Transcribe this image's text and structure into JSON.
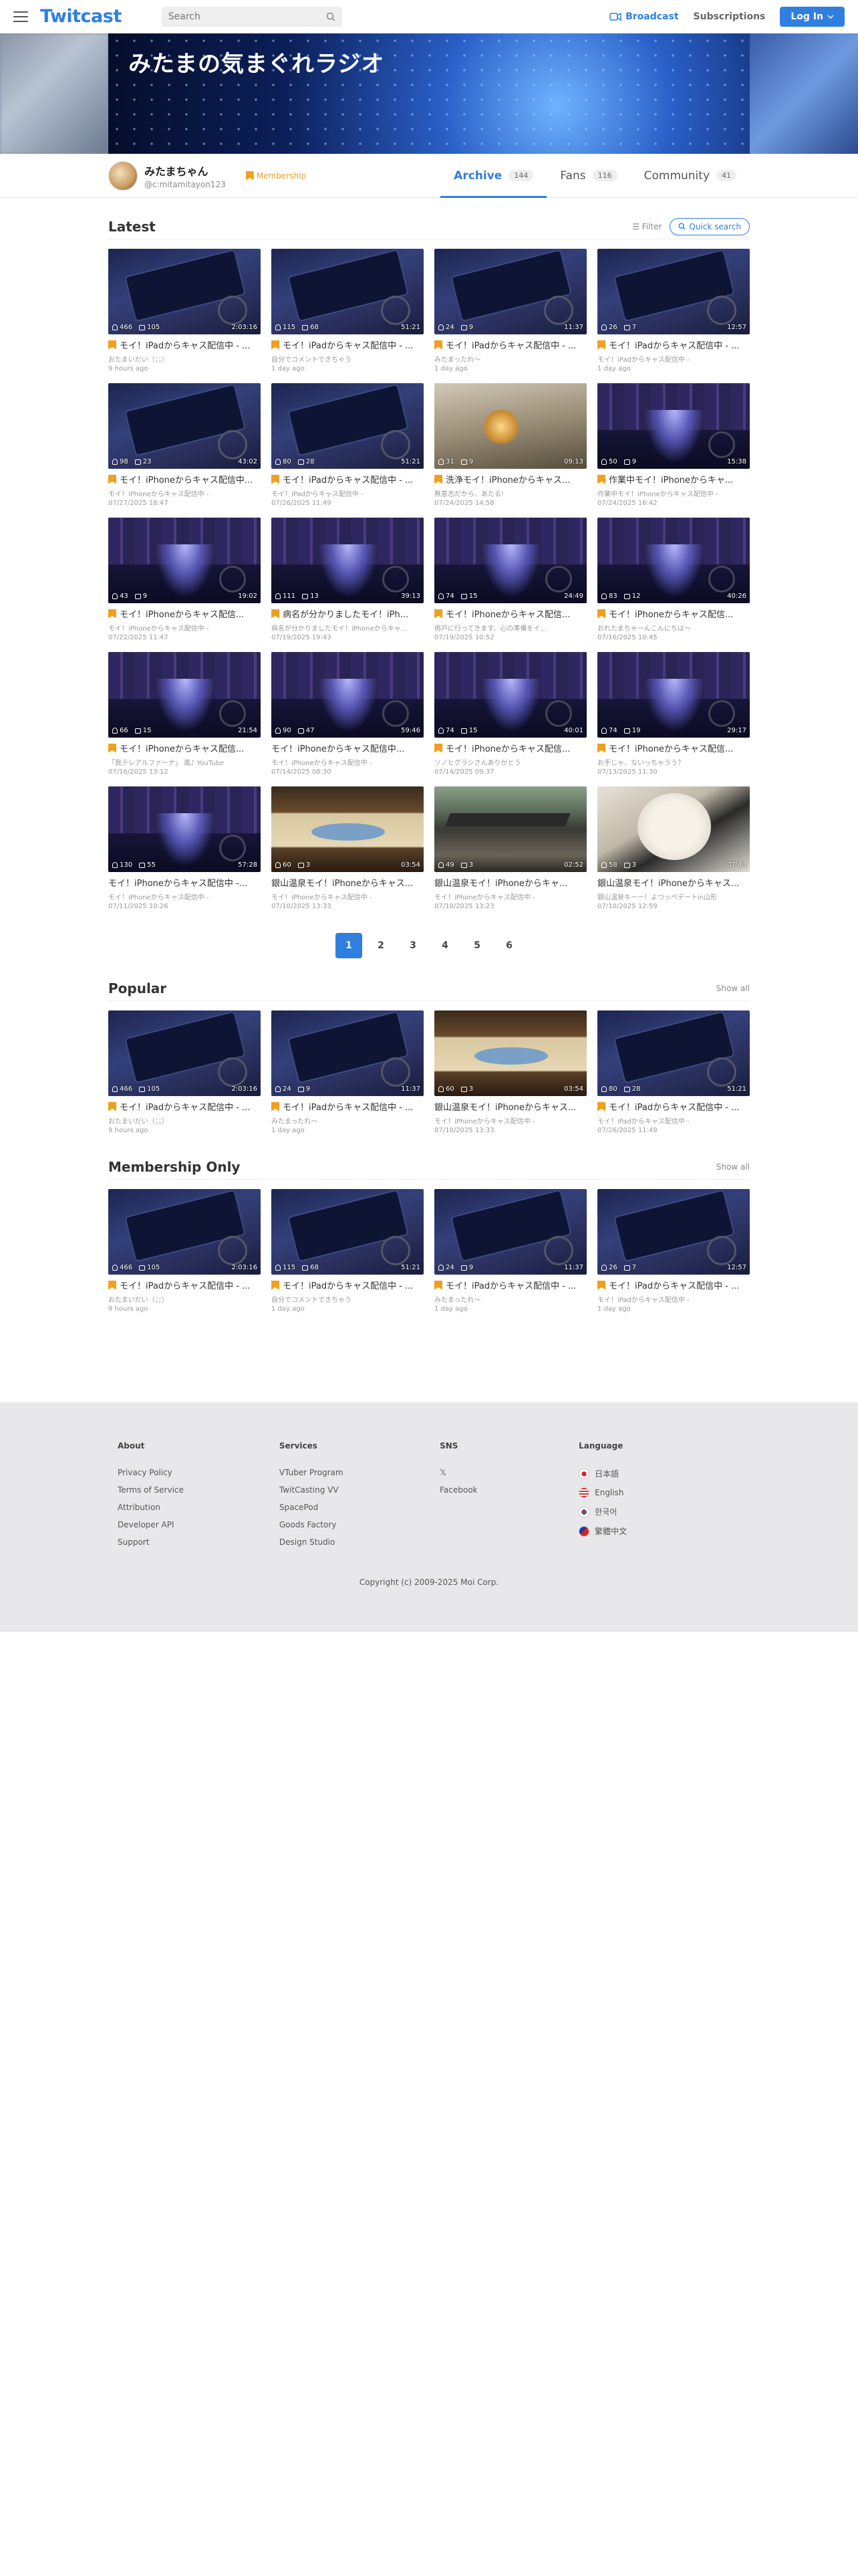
{
  "header": {
    "logo": "Twitcast",
    "search_placeholder": "Search",
    "broadcast": "Broadcast",
    "subscriptions": "Subscriptions",
    "login": "Log In"
  },
  "banner": {
    "title": "みたまの気まぐれラジオ"
  },
  "profile": {
    "name": "みたまちゃん",
    "id": "@c:mitamitayon123",
    "membership": "Membership",
    "tabs": [
      {
        "label": "Archive",
        "count": "144"
      },
      {
        "label": "Fans",
        "count": "116"
      },
      {
        "label": "Community",
        "count": "41"
      }
    ]
  },
  "latest": {
    "title": "Latest",
    "filter": "Filter",
    "quick_search": "Quick search",
    "items": [
      {
        "thumb": "ipad",
        "viewers": "466",
        "comments": "105",
        "dur": "2:03:16",
        "member": true,
        "title": "モイ！iPadからキャス配信中 - ...",
        "sub": "おたまいだい（；；）",
        "date": "9 hours ago"
      },
      {
        "thumb": "ipad",
        "viewers": "115",
        "comments": "68",
        "dur": "51:21",
        "member": true,
        "title": "モイ！iPadからキャス配信中 - ...",
        "sub": "自分でコメントできちゃう",
        "date": "1 day ago"
      },
      {
        "thumb": "ipad",
        "viewers": "24",
        "comments": "9",
        "dur": "11:37",
        "member": true,
        "title": "モイ！iPadからキャス配信中 - ...",
        "sub": "みたまったれ～",
        "date": "1 day ago"
      },
      {
        "thumb": "ipad",
        "viewers": "26",
        "comments": "7",
        "dur": "12:57",
        "member": true,
        "title": "モイ！iPadからキャス配信中 - ...",
        "sub": "モイ！iPadからキャス配信中 -",
        "date": "1 day ago"
      },
      {
        "thumb": "ipad",
        "viewers": "98",
        "comments": "23",
        "dur": "43:02",
        "member": true,
        "title": "モイ！iPhoneからキャス配信中...",
        "sub": "モイ！iPhoneからキャス配信中 -",
        "date": "07/27/2025 18:47"
      },
      {
        "thumb": "ipad",
        "viewers": "80",
        "comments": "28",
        "dur": "51:21",
        "member": true,
        "title": "モイ！iPadからキャス配信中 - ...",
        "sub": "モイ！iPadからキャス配信中 -",
        "date": "07/26/2025 11:49"
      },
      {
        "thumb": "room",
        "viewers": "31",
        "comments": "9",
        "dur": "09:13",
        "member": true,
        "title": "洗浄モイ！iPhoneからキャス...",
        "sub": "無意志だから、あたる!",
        "date": "07/24/2025 14:58"
      },
      {
        "thumb": "iph",
        "viewers": "50",
        "comments": "9",
        "dur": "15:38",
        "member": true,
        "title": "作業中モイ！iPhoneからキャ...",
        "sub": "作業中モイ！iPhoneからキャス配信中 -",
        "date": "07/24/2025 16:42"
      },
      {
        "thumb": "iph",
        "viewers": "43",
        "comments": "9",
        "dur": "19:02",
        "member": true,
        "title": "モイ！iPhoneからキャス配信...",
        "sub": "モイ！iPhoneからキャス配信中 -",
        "date": "07/22/2025 11:47"
      },
      {
        "thumb": "iph",
        "viewers": "111",
        "comments": "13",
        "dur": "39:13",
        "member": true,
        "title": "病名が分かりましたモイ！iPh...",
        "sub": "病名が分かりましたモイ！iPhoneからキャ...",
        "date": "07/19/2025 19:43"
      },
      {
        "thumb": "iph",
        "viewers": "74",
        "comments": "15",
        "dur": "24:49",
        "member": true,
        "title": "モイ！iPhoneからキャス配信...",
        "sub": "雨戸に行ってきます、心の準備をイ...",
        "date": "07/19/2025 10:52"
      },
      {
        "thumb": "iph",
        "viewers": "83",
        "comments": "12",
        "dur": "40:26",
        "member": true,
        "title": "モイ！iPhoneからキャス配信...",
        "sub": "おれたまちゃーんこんにちは～",
        "date": "07/16/2025 10:45"
      },
      {
        "thumb": "iph",
        "viewers": "66",
        "comments": "15",
        "dur": "21:54",
        "member": true,
        "title": "モイ！iPhoneからキャス配信...",
        "sub": "「我テレアルファーナ」 風♪ YouTube",
        "date": "07/16/2025 13:12"
      },
      {
        "thumb": "iph",
        "viewers": "90",
        "comments": "47",
        "dur": "59:46",
        "member": false,
        "title": "モイ！iPhoneからキャス配信中...",
        "sub": "モイ！iPhoneからキャス配信中 -",
        "date": "07/14/2025 08:30"
      },
      {
        "thumb": "iph",
        "viewers": "74",
        "comments": "15",
        "dur": "40:01",
        "member": true,
        "title": "モイ！iPhoneからキャス配信...",
        "sub": "ソノヒグラシさんありがとう",
        "date": "07/14/2025 09:37"
      },
      {
        "thumb": "iph",
        "viewers": "74",
        "comments": "19",
        "dur": "29:17",
        "member": true,
        "title": "モイ！iPhoneからキャス配信...",
        "sub": "お手じゃ、ないっちゃうう？",
        "date": "07/13/2025 11:30"
      },
      {
        "thumb": "iph",
        "viewers": "130",
        "comments": "55",
        "dur": "57:28",
        "member": false,
        "title": "モイ！iPhoneからキャス配信中 -...",
        "sub": "モイ！iPhoneからキャス配信中 -",
        "date": "07/11/2025 10:26"
      },
      {
        "thumb": "sign",
        "viewers": "60",
        "comments": "3",
        "dur": "03:54",
        "member": false,
        "title": "銀山温泉モイ！iPhoneからキャス...",
        "sub": "モイ！iPhoneからキャス配信中 -",
        "date": "07/10/2025 13:33"
      },
      {
        "thumb": "town",
        "viewers": "49",
        "comments": "3",
        "dur": "02:52",
        "member": false,
        "title": "銀山温泉モイ！iPhoneからキャ...",
        "sub": "モイ！iPhoneからキャス配信中 -",
        "date": "07/10/2025 13:23"
      },
      {
        "thumb": "food",
        "viewers": "58",
        "comments": "3",
        "dur": "07:43",
        "member": false,
        "title": "銀山温泉モイ！iPhoneからキャス...",
        "sub": "銀山温泉キーー！よつッペデートin山形",
        "date": "07/10/2025 12:59"
      }
    ],
    "pages": [
      "1",
      "2",
      "3",
      "4",
      "5",
      "6"
    ]
  },
  "popular": {
    "title": "Popular",
    "show_all": "Show all",
    "items": [
      {
        "thumb": "ipad",
        "viewers": "466",
        "comments": "105",
        "dur": "2:03:16",
        "member": true,
        "title": "モイ！iPadからキャス配信中 - ...",
        "sub": "おたまいだい（；；）",
        "date": "9 hours ago"
      },
      {
        "thumb": "ipad",
        "viewers": "24",
        "comments": "9",
        "dur": "11:37",
        "member": true,
        "title": "モイ！iPadからキャス配信中 - ...",
        "sub": "みたまったれ～",
        "date": "1 day ago"
      },
      {
        "thumb": "sign",
        "viewers": "60",
        "comments": "3",
        "dur": "03:54",
        "member": false,
        "title": "銀山温泉モイ！iPhoneからキャス...",
        "sub": "モイ！iPhoneからキャス配信中 -",
        "date": "07/10/2025 13:33"
      },
      {
        "thumb": "ipad",
        "viewers": "80",
        "comments": "28",
        "dur": "51:21",
        "member": true,
        "title": "モイ！iPadからキャス配信中 - ...",
        "sub": "モイ！iPadからキャス配信中 -",
        "date": "07/26/2025 11:49"
      }
    ]
  },
  "membership_only": {
    "title": "Membership Only",
    "show_all": "Show all",
    "items": [
      {
        "thumb": "ipad",
        "viewers": "466",
        "comments": "105",
        "dur": "2:03:16",
        "member": true,
        "title": "モイ！iPadからキャス配信中 - ...",
        "sub": "おたまいだい（；；）",
        "date": "9 hours ago"
      },
      {
        "thumb": "ipad",
        "viewers": "115",
        "comments": "68",
        "dur": "51:21",
        "member": true,
        "title": "モイ！iPadからキャス配信中 - ...",
        "sub": "自分でコメントできちゃう",
        "date": "1 day ago"
      },
      {
        "thumb": "ipad",
        "viewers": "24",
        "comments": "9",
        "dur": "11:37",
        "member": true,
        "title": "モイ！iPadからキャス配信中 - ...",
        "sub": "みたまったれ～",
        "date": "1 day ago"
      },
      {
        "thumb": "ipad",
        "viewers": "26",
        "comments": "7",
        "dur": "12:57",
        "member": true,
        "title": "モイ！iPadからキャス配信中 - ...",
        "sub": "モイ！iPadからキャス配信中 -",
        "date": "1 day ago"
      }
    ]
  },
  "footer": {
    "about": {
      "title": "About",
      "links": [
        "Privacy Policy",
        "Terms of Service",
        "Attribution",
        "Developer API",
        "Support"
      ]
    },
    "services": {
      "title": "Services",
      "links": [
        "VTuber Program",
        "TwitCasting VV",
        "SpacePod",
        "Goods Factory",
        "Design Studio"
      ]
    },
    "sns": {
      "title": "SNS",
      "links": [
        "𝕏",
        "Facebook"
      ]
    },
    "language": {
      "title": "Language",
      "links": [
        "日本語",
        "English",
        "한국어",
        "繁體中文"
      ]
    },
    "copyright": "Copyright (c) 2009-2025 Moi Corp."
  },
  "colors": {
    "accent": "#2e7fe0",
    "membership": "#f0a020",
    "footer_bg": "#e8e8ea"
  }
}
